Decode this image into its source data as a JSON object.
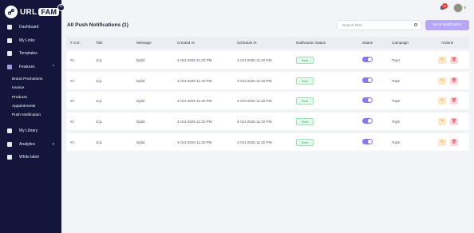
{
  "app": {
    "brand_left": "URL",
    "brand_right": "FAM",
    "collapse_icon": "<"
  },
  "sidebar": {
    "items": [
      {
        "label": "Dashboard"
      },
      {
        "label": "My Links"
      },
      {
        "label": "Templates"
      },
      {
        "label": "Features",
        "chevron": "^"
      }
    ],
    "subitems": [
      "Brand Promotions",
      "Invoice",
      "Products",
      "Appointments",
      "Push Notification"
    ],
    "items2": [
      {
        "label": "My Library"
      },
      {
        "label": "Analytics",
        "chevron": "v"
      },
      {
        "label": "White label"
      }
    ]
  },
  "topbar": {
    "notification_count": "11",
    "avatar_chevron": "v"
  },
  "page": {
    "title": "All Push Notifications (1)"
  },
  "search": {
    "placeholder": "Search here"
  },
  "actions": {
    "send_label": "Send Notification",
    "edit_glyph": "✎",
    "delete_glyph": "🗑"
  },
  "table": {
    "headers": [
      "# S.N.",
      "Title",
      "Message",
      "Created At",
      "Schedule At",
      "Notification Status",
      "Status",
      "Campaign",
      "Actions"
    ],
    "rows": [
      {
        "sn": "#1",
        "title": "Jcjc",
        "message": "Djdid",
        "created": "4-Oct-2025 11:20 PM",
        "schedule": "4-Oct-2025 11:20 PM",
        "status": "Sent",
        "campaign": "Top4"
      },
      {
        "sn": "#1",
        "title": "Jcjc",
        "message": "Djdid",
        "created": "4-Oct-2025 11:20 PM",
        "schedule": "4-Oct-2025 11:20 PM",
        "status": "Sent",
        "campaign": "Top5"
      },
      {
        "sn": "#1",
        "title": "Jcjc",
        "message": "Djdid",
        "created": "4-Oct-2025 11:20 PM",
        "schedule": "4-Oct-2025 11:20 PM",
        "status": "Sent",
        "campaign": "Top5"
      },
      {
        "sn": "#1",
        "title": "Jcjc",
        "message": "Djdid",
        "created": "4-Oct-2025 11:20 PM",
        "schedule": "4-Oct-2025 11:20 PM",
        "status": "Sent",
        "campaign": "Top5"
      },
      {
        "sn": "#1",
        "title": "Jcjc",
        "message": "Djdid",
        "created": "4-Oct-2025 11:20 PM",
        "schedule": "4-Oct-2025 11:20 PM",
        "status": "Sent",
        "campaign": "Top5"
      }
    ]
  },
  "colors": {
    "sidebar_bg": "#13163a",
    "accent": "#b6a6f5",
    "toggle_on": "#8a78e8"
  }
}
